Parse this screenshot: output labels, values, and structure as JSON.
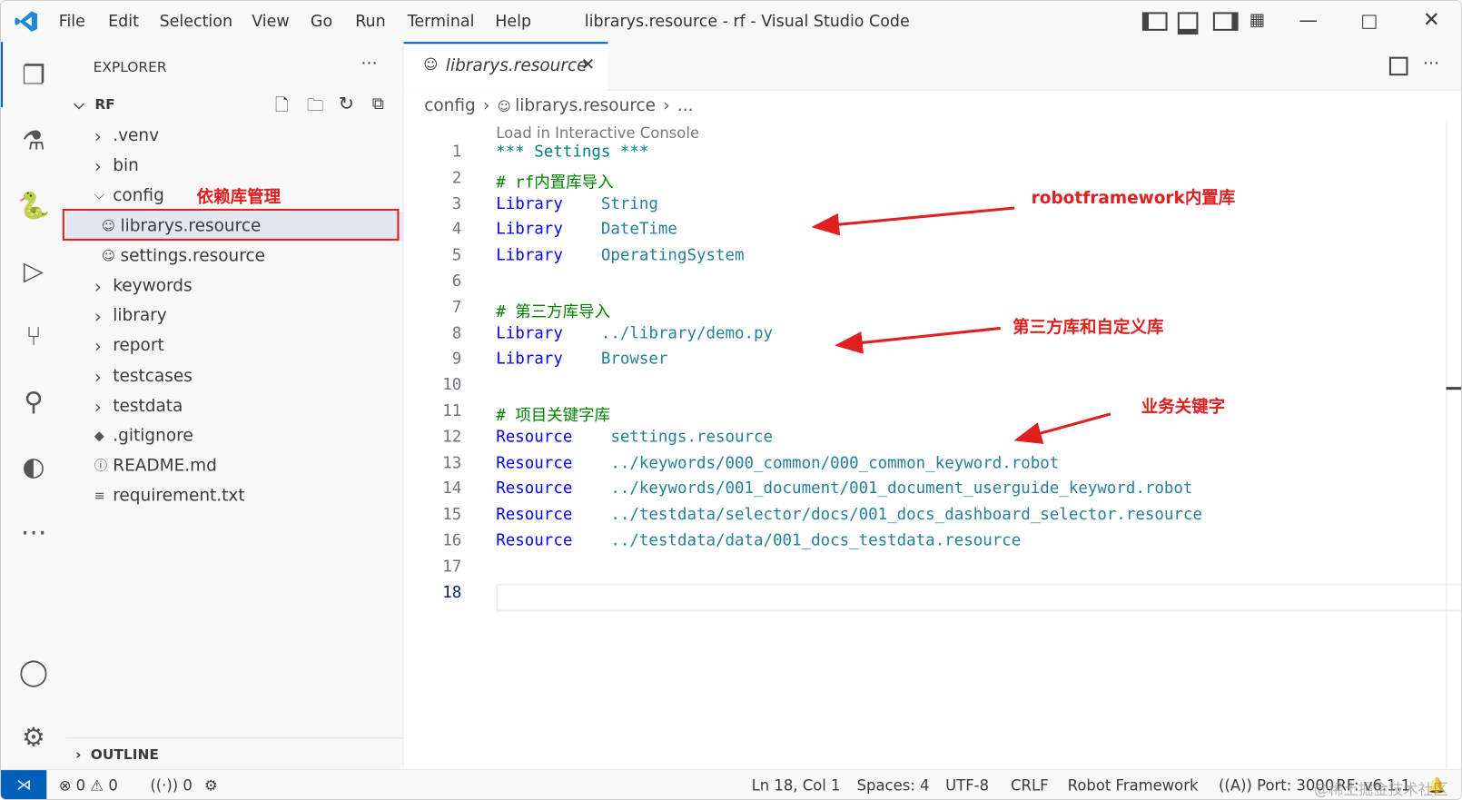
{
  "titlebar": {
    "menus": [
      "File",
      "Edit",
      "Selection",
      "View",
      "Go",
      "Run",
      "Terminal",
      "Help"
    ],
    "title": "librarys.resource - rf - Visual Studio Code"
  },
  "sidebar": {
    "header": "EXPLORER",
    "root": "RF",
    "outline": "OUTLINE",
    "items": [
      {
        "label": ".venv",
        "type": "folder"
      },
      {
        "label": "bin",
        "type": "folder"
      },
      {
        "label": "config",
        "type": "folder-open"
      },
      {
        "label": "librarys.resource",
        "type": "file",
        "selected": true
      },
      {
        "label": "settings.resource",
        "type": "file"
      },
      {
        "label": "keywords",
        "type": "folder"
      },
      {
        "label": "library",
        "type": "folder"
      },
      {
        "label": "report",
        "type": "folder"
      },
      {
        "label": "testcases",
        "type": "folder"
      },
      {
        "label": "testdata",
        "type": "folder"
      },
      {
        "label": ".gitignore",
        "type": "git"
      },
      {
        "label": "README.md",
        "type": "info"
      },
      {
        "label": "requirement.txt",
        "type": "text"
      }
    ]
  },
  "editor": {
    "tab": "librarys.resource",
    "breadcrumb": [
      "config",
      "librarys.resource",
      "..."
    ],
    "codelens": "Load in Interactive Console",
    "active_line": 18,
    "lines": [
      {
        "n": "1",
        "parts": [
          [
            "hd",
            "*** Settings ***"
          ]
        ]
      },
      {
        "n": "2",
        "parts": [
          [
            "cm",
            "# rf内置库导入"
          ]
        ]
      },
      {
        "n": "3",
        "parts": [
          [
            "kw",
            "Library"
          ],
          [
            "arg",
            "    String"
          ]
        ]
      },
      {
        "n": "4",
        "parts": [
          [
            "kw",
            "Library"
          ],
          [
            "arg",
            "    DateTime"
          ]
        ]
      },
      {
        "n": "5",
        "parts": [
          [
            "kw",
            "Library"
          ],
          [
            "arg",
            "    OperatingSystem"
          ]
        ]
      },
      {
        "n": "6",
        "parts": []
      },
      {
        "n": "7",
        "parts": [
          [
            "cm",
            "# 第三方库导入"
          ]
        ]
      },
      {
        "n": "8",
        "parts": [
          [
            "kw",
            "Library"
          ],
          [
            "arg",
            "    ../library/demo.py"
          ]
        ]
      },
      {
        "n": "9",
        "parts": [
          [
            "kw",
            "Library"
          ],
          [
            "arg",
            "    Browser"
          ]
        ]
      },
      {
        "n": "10",
        "parts": []
      },
      {
        "n": "11",
        "parts": [
          [
            "cm",
            "# 项目关键字库"
          ]
        ]
      },
      {
        "n": "12",
        "parts": [
          [
            "kw",
            "Resource"
          ],
          [
            "arg",
            "    settings.resource"
          ]
        ]
      },
      {
        "n": "13",
        "parts": [
          [
            "kw",
            "Resource"
          ],
          [
            "arg",
            "    ../keywords/000_common/000_common_keyword.robot"
          ]
        ]
      },
      {
        "n": "14",
        "parts": [
          [
            "kw",
            "Resource"
          ],
          [
            "arg",
            "    ../keywords/001_document/001_document_userguide_keyword.robot"
          ]
        ]
      },
      {
        "n": "15",
        "parts": [
          [
            "kw",
            "Resource"
          ],
          [
            "arg",
            "    ../testdata/selector/docs/001_docs_dashboard_selector.resource"
          ]
        ]
      },
      {
        "n": "16",
        "parts": [
          [
            "kw",
            "Resource"
          ],
          [
            "arg",
            "    ../testdata/data/001_docs_testdata.resource"
          ]
        ]
      },
      {
        "n": "17",
        "parts": []
      },
      {
        "n": "18",
        "parts": []
      }
    ]
  },
  "annotations": {
    "config": "依赖库管理",
    "builtin": "robotframework内置库",
    "thirdparty": "第三方库和自定义库",
    "business": "业务关键字",
    "color": "#e02020"
  },
  "statusbar": {
    "errors": "0",
    "warnings": "0",
    "ports": "0",
    "position": "Ln 18, Col 1",
    "spaces": "Spaces: 4",
    "encoding": "UTF-8",
    "eol": "CRLF",
    "language": "Robot Framework",
    "port": "Port: 3000",
    "rf": "RF: v6.1.1"
  },
  "watermark": "@稀土掘金技术社区"
}
